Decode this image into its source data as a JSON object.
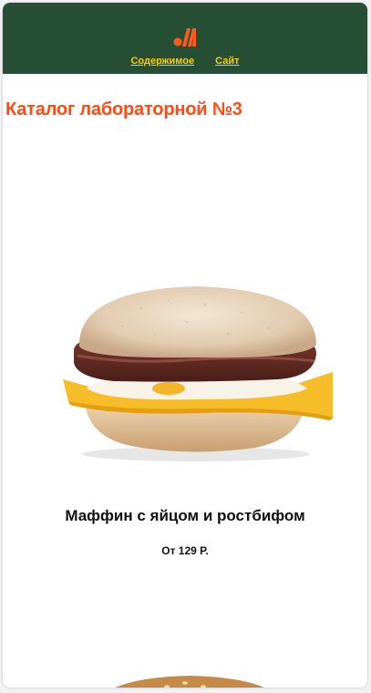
{
  "header": {
    "logo_icon": "golden-arches-logo-icon",
    "nav": {
      "contents": "Содержимое",
      "site": "Сайт"
    }
  },
  "catalog": {
    "title": "Каталог лабораторной №3"
  },
  "products": [
    {
      "name": "Маффин с яйцом и ростбифом",
      "price": "От 129 Р.",
      "image_icon": "muffin-egg-roastbeef-image"
    }
  ],
  "colors": {
    "header_bg": "#264f36",
    "nav_link": "#ffcc00",
    "title": "#ff4a14",
    "logo": "#ff5a1f"
  }
}
